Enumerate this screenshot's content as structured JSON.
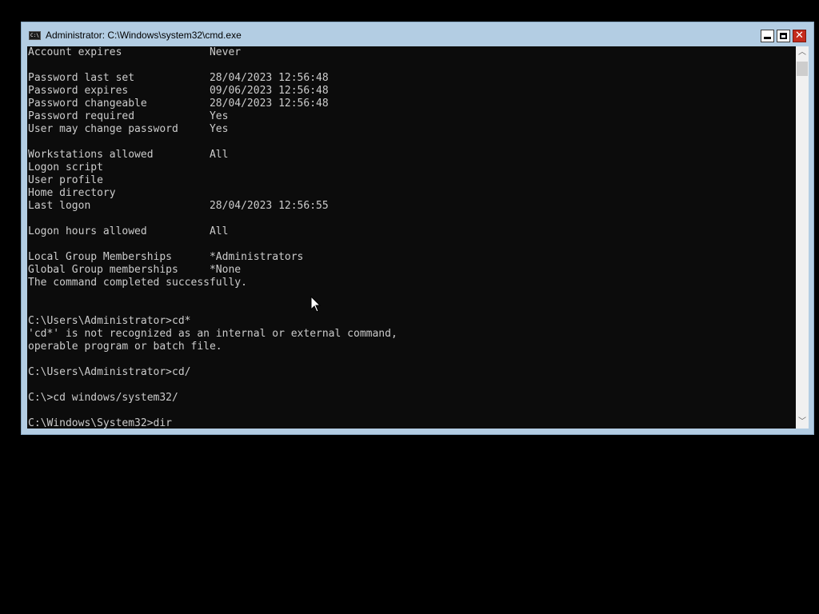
{
  "window": {
    "title": "Administrator: C:\\Windows\\system32\\cmd.exe",
    "icon_text": "C:\\"
  },
  "console": {
    "lines": [
      "Account expires              Never",
      "",
      "Password last set            28/04/2023 12:56:48",
      "Password expires             09/06/2023 12:56:48",
      "Password changeable          28/04/2023 12:56:48",
      "Password required            Yes",
      "User may change password     Yes",
      "",
      "Workstations allowed         All",
      "Logon script",
      "User profile",
      "Home directory",
      "Last logon                   28/04/2023 12:56:55",
      "",
      "Logon hours allowed          All",
      "",
      "Local Group Memberships      *Administrators",
      "Global Group memberships     *None",
      "The command completed successfully.",
      "",
      "",
      "C:\\Users\\Administrator>cd*",
      "'cd*' is not recognized as an internal or external command,",
      "operable program or batch file.",
      "",
      "C:\\Users\\Administrator>cd/",
      "",
      "C:\\>cd windows/system32/",
      "",
      "C:\\Windows\\System32>dir"
    ]
  },
  "scrollbar": {
    "up_icon": "chevron-up-icon",
    "down_icon": "chevron-down-icon"
  },
  "colors": {
    "console_background": "#0c0c0c",
    "console_text": "#cccccc",
    "window_frame": "#b3cde3",
    "close_button": "#c42b1c"
  }
}
